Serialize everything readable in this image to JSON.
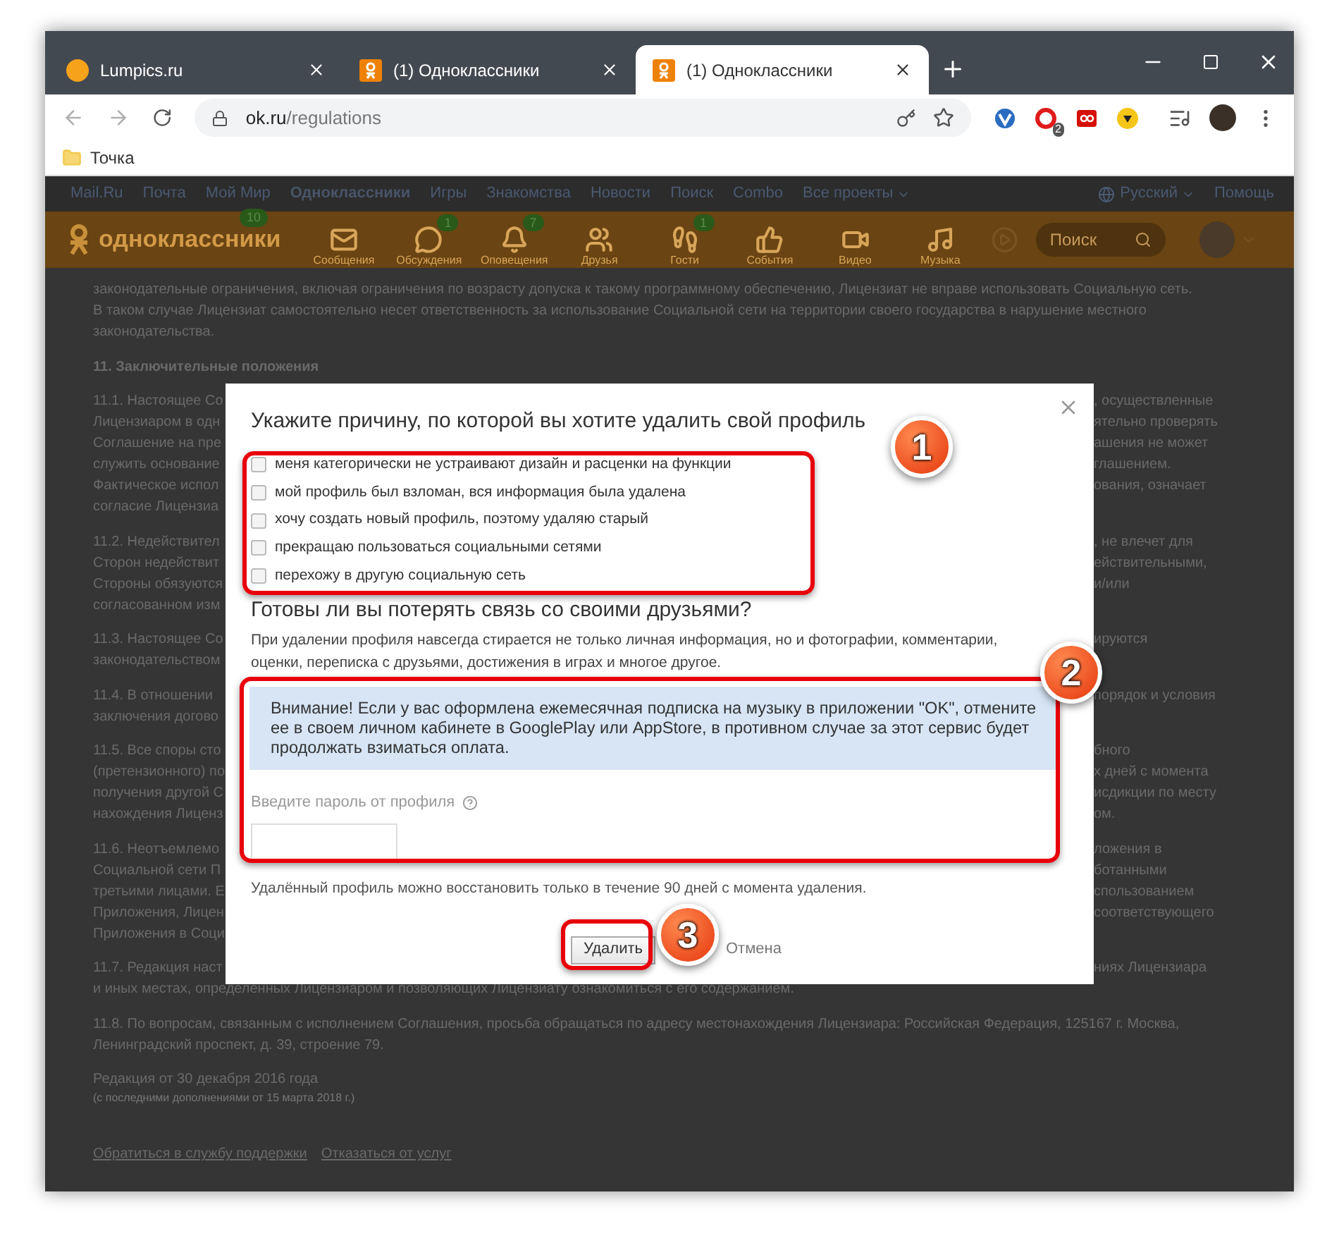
{
  "browser": {
    "tabs": [
      {
        "title": "Lumpics.ru",
        "kind": "lumpics",
        "selected": false
      },
      {
        "title": "(1) Одноклассники",
        "kind": "ok",
        "selected": false
      },
      {
        "title": "(1) Одноклассники",
        "kind": "ok",
        "selected": true
      }
    ],
    "url": {
      "host": "ok.ru",
      "path": "/regulations"
    },
    "extension_badge": "2",
    "bookmarks": [
      "Точка"
    ]
  },
  "topnav": {
    "items": [
      {
        "label": "Mail.Ru",
        "selected": false
      },
      {
        "label": "Почта",
        "selected": false
      },
      {
        "label": "Мой Мир",
        "selected": false
      },
      {
        "label": "Одноклассники",
        "selected": true
      },
      {
        "label": "Игры",
        "selected": false
      },
      {
        "label": "Знакомства",
        "selected": false
      },
      {
        "label": "Новости",
        "selected": false
      },
      {
        "label": "Поиск",
        "selected": false
      },
      {
        "label": "Combo",
        "selected": false
      },
      {
        "label": "Все проекты",
        "selected": false
      }
    ],
    "language": "Русский",
    "help": "Помощь"
  },
  "header": {
    "logo": "одноклассники",
    "logo_badge": "10",
    "items": [
      {
        "label": "Сообщения",
        "kind": "messages"
      },
      {
        "label": "Обсуждения",
        "kind": "discussions",
        "count": "1"
      },
      {
        "label": "Оповещения",
        "kind": "notifications",
        "count": "7"
      },
      {
        "label": "Друзья",
        "kind": "friends"
      },
      {
        "label": "Гости",
        "kind": "guests",
        "count": "1"
      },
      {
        "label": "События",
        "kind": "events"
      },
      {
        "label": "Видео",
        "kind": "video"
      },
      {
        "label": "Музыка",
        "kind": "music"
      }
    ],
    "search_placeholder": "Поиск"
  },
  "page": {
    "paragraphs": [
      {
        "lines": [
          {
            "text": "законодательные ограничения, включая ограничения по возрасту допуска к такому программному обеспечению, Лицензиат не вправе использовать Социальную сеть."
          },
          {
            "text": "В таком случае Лицензиат самостоятельно несет ответственность за использование Социальной сети на территории своего государства в нарушение местного"
          },
          {
            "text": "законодательства."
          }
        ]
      },
      {
        "heading": true,
        "lines": [
          {
            "text": "11. Заключительные положения"
          }
        ]
      },
      {
        "lines": [
          {
            "left": "11.1. Настоящее Со",
            "right": ", осуществленные"
          },
          {
            "left": "Лицензиаром в одн",
            "right": "ятельно проверять"
          },
          {
            "left": "Соглашение на пре",
            "right": "ашения не может"
          },
          {
            "left": "служить основание",
            "right": "глашением."
          },
          {
            "left": "Фактическое испол",
            "right": "ования, означает"
          },
          {
            "left": "согласие Лицензиа"
          }
        ]
      },
      {
        "lines": [
          {
            "left": "11.2. Недействител",
            "right": ", не влечет для"
          },
          {
            "left": "Сторон недействит",
            "right": "ействительными,"
          },
          {
            "left": "Стороны обязуются",
            "right": "и/или"
          },
          {
            "left": "согласованном изм"
          }
        ]
      },
      {
        "lines": [
          {
            "left": "11.3. Настоящее Со",
            "right": "ируются"
          },
          {
            "left": "законодательством"
          }
        ]
      },
      {
        "lines": [
          {
            "left": "11.4. В отношении",
            "right": "порядок и условия"
          },
          {
            "left": "заключения догово"
          }
        ]
      },
      {
        "lines": [
          {
            "left": "11.5. Все споры сто",
            "right": "бного"
          },
          {
            "left": "(претензионного) по",
            "right": "х дней с момента"
          },
          {
            "left": "получения другой С",
            "right": "исдикции по месту"
          },
          {
            "left": "нахождения Лиценз",
            "right": "ом."
          }
        ]
      },
      {
        "lines": [
          {
            "left": "11.6. Неотъемлемо",
            "right": "ложения в"
          },
          {
            "left": "Социальной сети П",
            "right": "ботанными"
          },
          {
            "left": "третьими лицами. Е",
            "right": "спользованием"
          },
          {
            "left": "Приложения, Лицен",
            "right": "соответствующего"
          },
          {
            "left": "Приложения в Соци"
          }
        ]
      },
      {
        "lines": [
          {
            "left": "11.7. Редакция наст",
            "right": "ниях Лицензиара"
          },
          {
            "text": "и иных местах, определенных Лицензиаром и позволяющих Лицензиату ознакомиться с его содержанием."
          }
        ]
      },
      {
        "lines": [
          {
            "text": "11.8. По вопросам, связанным с исполнением Соглашения, просьба обращаться по адресу местонахождения Лицензиара: Российская Федерация, 125167 г. Москва,"
          },
          {
            "text": "Ленинградский проспект, д. 39, строение 79."
          }
        ]
      }
    ],
    "edition": "Редакция от 30 декабря 2016 года",
    "edition_note": "(с последними дополнениями от 15 марта 2018 г.)",
    "footer_links": [
      "Обратиться в службу поддержки",
      "Отказаться от услуг"
    ]
  },
  "dialog": {
    "title": "Укажите причину, по которой вы хотите удалить свой профиль",
    "reasons": [
      {
        "label": "меня категорически не устраивают дизайн и расценки на функции",
        "checked": false
      },
      {
        "label": "мой профиль был взломан, вся информация была удалена",
        "checked": false
      },
      {
        "label": "хочу создать новый профиль, поэтому удаляю старый",
        "checked": false
      },
      {
        "label": "прекращаю пользоваться социальными сетями",
        "checked": false
      },
      {
        "label": "перехожу в другую социальную сеть",
        "checked": false
      }
    ],
    "question": "Готовы ли вы потерять связь со своими друзьями?",
    "warning": "При удалении профиля навсегда стирается не только личная информация, но и фотографии, комментарии, оценки, переписка с друзьями, достижения в играх и многое другое.",
    "notice": "Внимание! Если у вас оформлена ежемесячная подписка на музыку в приложении \"OK\", отмените ее в своем личном кабинете в GooglePlay или AppStore, в противном случае за этот сервис будет продолжать взиматься оплата.",
    "password_label": "Введите пароль от профиля",
    "restore_note": "Удалённый профиль можно восстановить только в течение 90 дней с момента удаления.",
    "delete_button": "Удалить",
    "cancel_link": "Отмена"
  },
  "annotations": [
    "1",
    "2",
    "3"
  ]
}
